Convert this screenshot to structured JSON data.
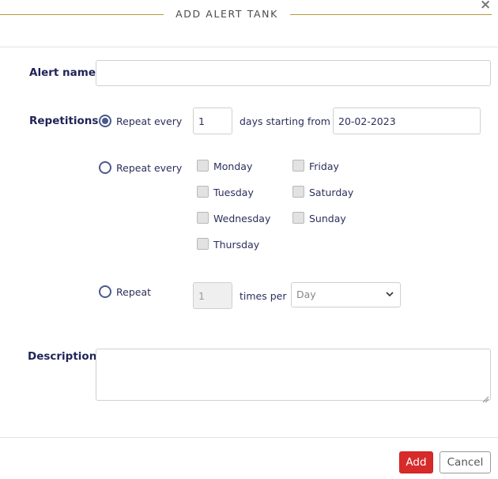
{
  "dialog": {
    "title": "ADD ALERT TANK",
    "close_symbol": "×"
  },
  "form": {
    "alert_name": {
      "label": "Alert name",
      "value": ""
    },
    "repetitions": {
      "label": "Repetitions",
      "option1": {
        "label": "Repeat every",
        "days_value": "1",
        "days_text": "days starting from",
        "start_date": "20-02-2023",
        "selected": true
      },
      "option2": {
        "label": "Repeat every",
        "selected": false,
        "days": [
          "Monday",
          "Tuesday",
          "Wednesday",
          "Thursday",
          "Friday",
          "Saturday",
          "Sunday"
        ]
      },
      "option3": {
        "label": "Repeat",
        "times_value": "1",
        "times_text": "times per",
        "period_selected": "Day",
        "selected": false
      }
    },
    "description": {
      "label": "Description",
      "value": ""
    }
  },
  "footer": {
    "add_label": "Add",
    "cancel_label": "Cancel"
  },
  "colors": {
    "accent_gold": "#b79a3c",
    "primary_red": "#d72b2b",
    "label_navy": "#1f2458"
  },
  "icons": {
    "close": "close-icon",
    "dropdown": "chevron-down-icon",
    "resize": "resize-grip-icon"
  }
}
